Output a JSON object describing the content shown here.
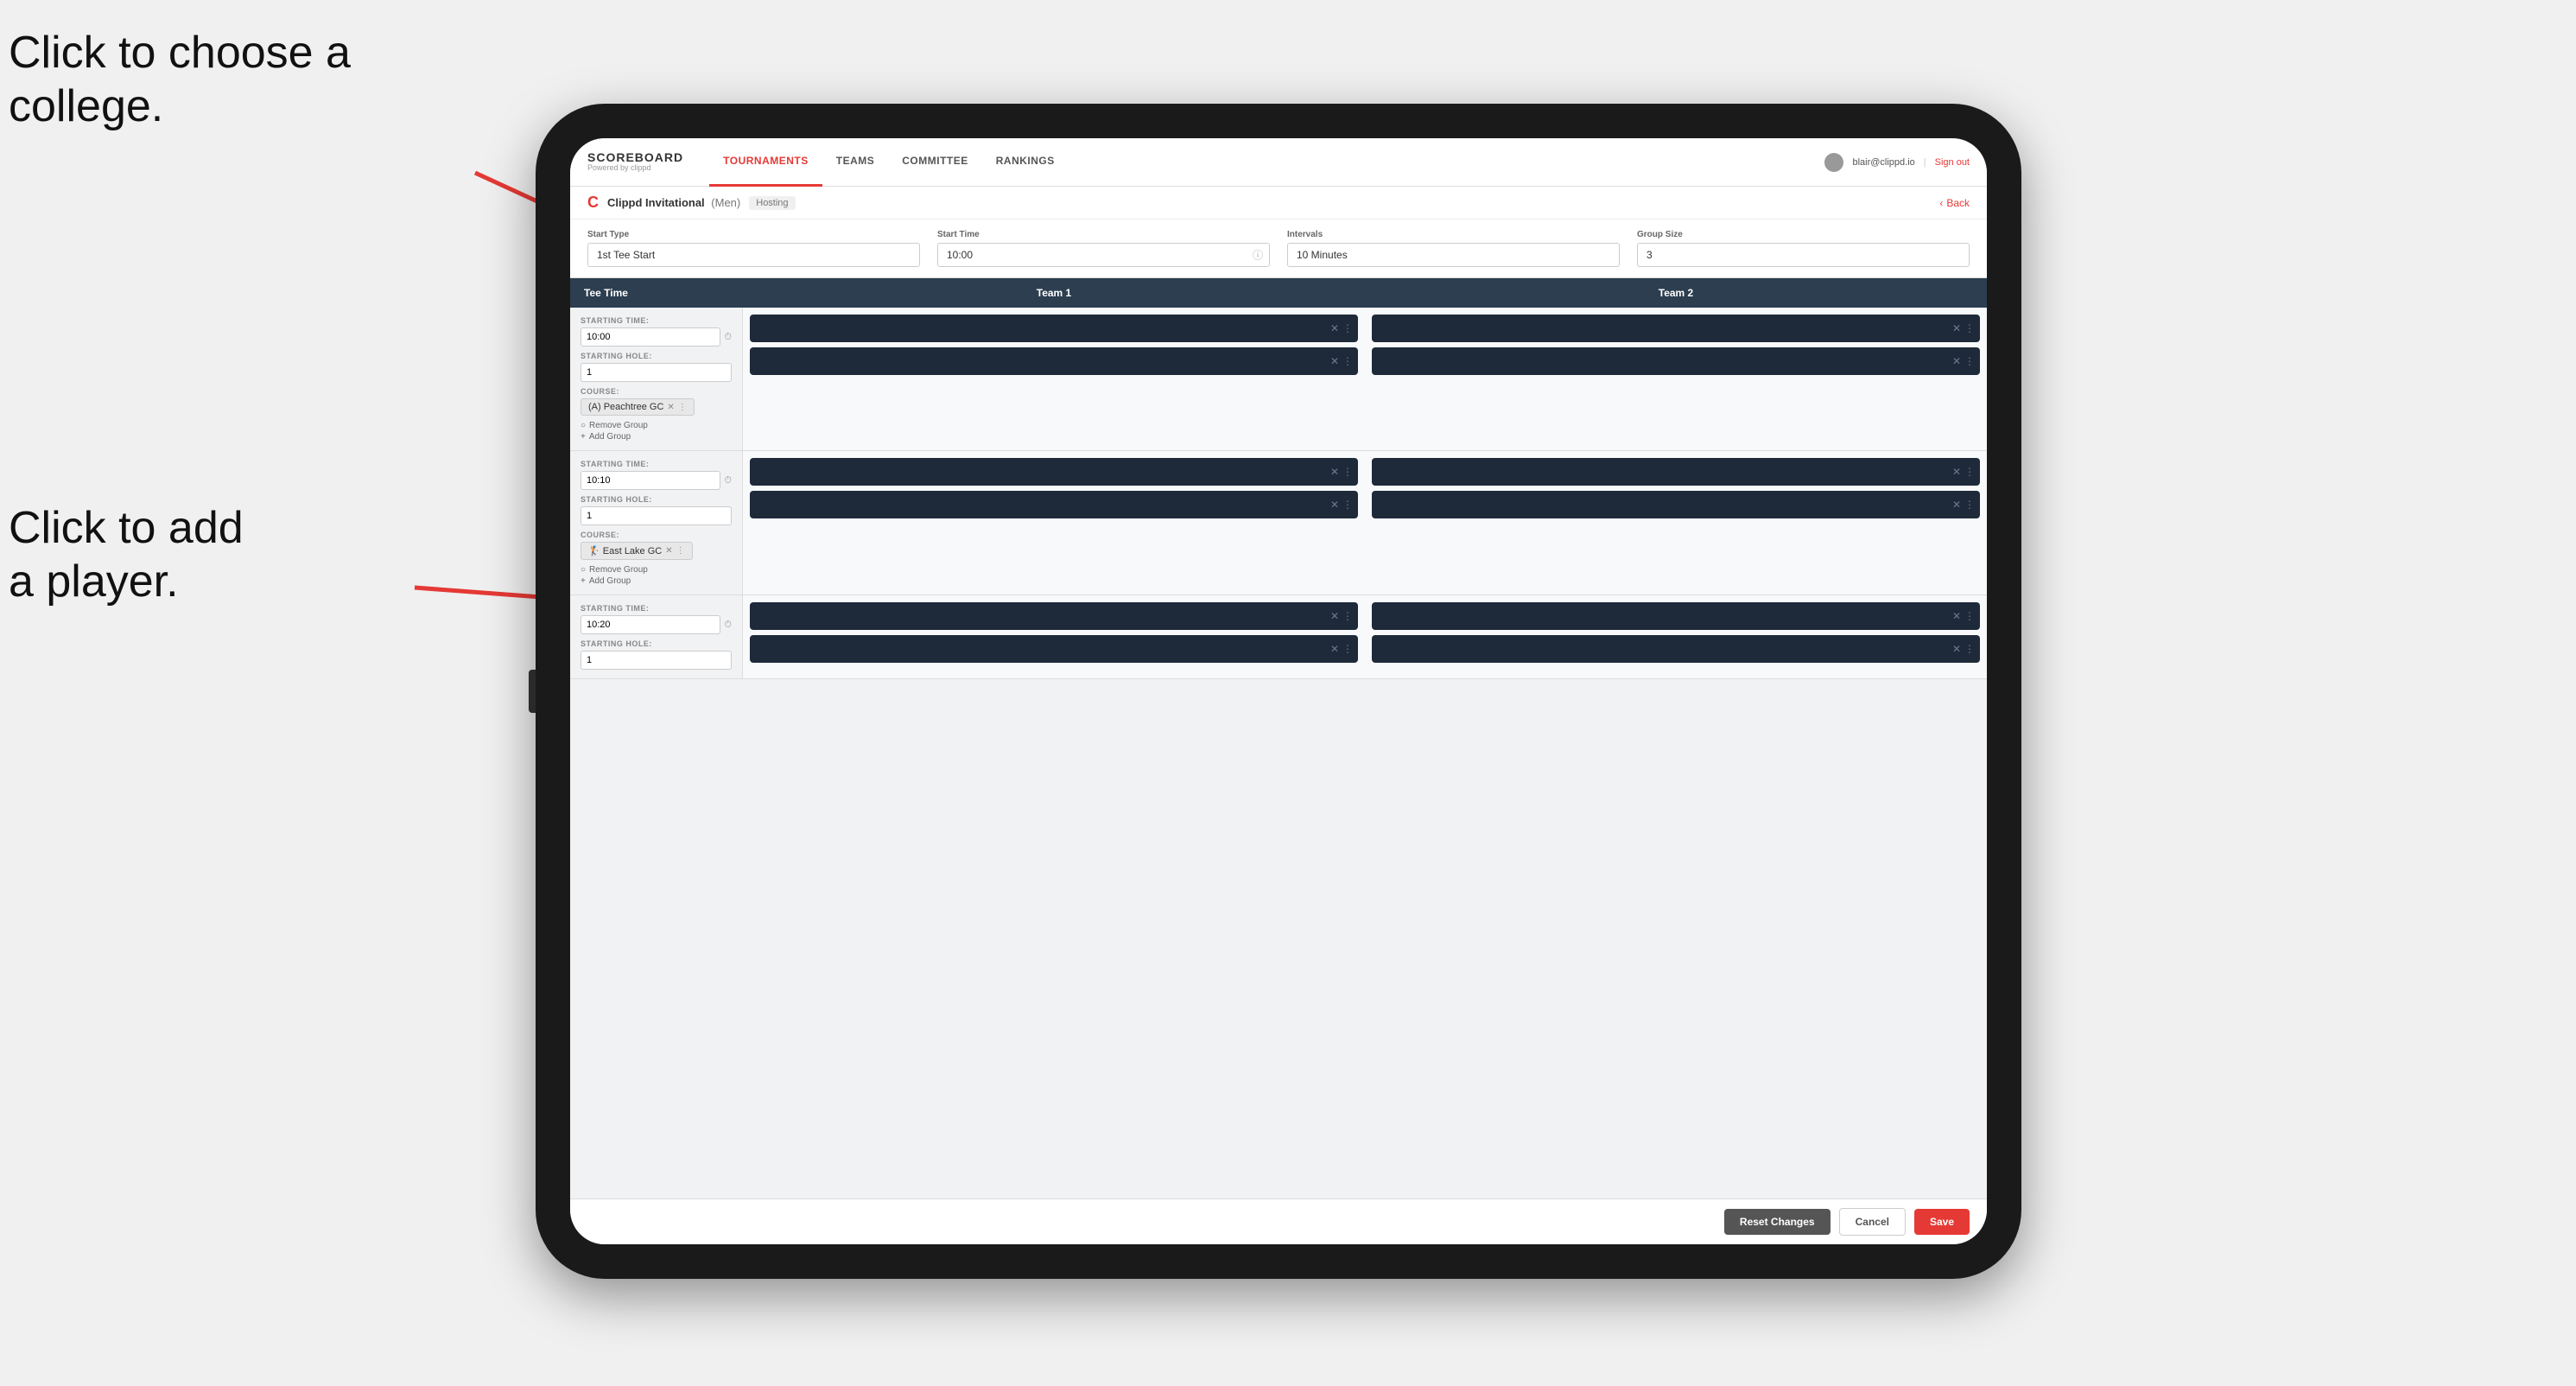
{
  "annotations": {
    "text1_line1": "Click to choose a",
    "text1_line2": "college.",
    "text2_line1": "Click to add",
    "text2_line2": "a player."
  },
  "nav": {
    "brand": "SCOREBOARD",
    "powered_by": "Powered by clippd",
    "links": [
      "TOURNAMENTS",
      "TEAMS",
      "COMMITTEE",
      "RANKINGS"
    ],
    "active_link": "TOURNAMENTS",
    "user_email": "blair@clippd.io",
    "sign_out": "Sign out"
  },
  "breadcrumb": {
    "tournament_name": "Clippd Invitational",
    "gender": "(Men)",
    "status": "Hosting",
    "back_label": "Back"
  },
  "settings": {
    "start_type_label": "Start Type",
    "start_type_value": "1st Tee Start",
    "start_time_label": "Start Time",
    "start_time_value": "10:00",
    "intervals_label": "Intervals",
    "intervals_value": "10 Minutes",
    "group_size_label": "Group Size",
    "group_size_value": "3"
  },
  "table": {
    "tee_time_col": "Tee Time",
    "team1_col": "Team 1",
    "team2_col": "Team 2"
  },
  "groups": [
    {
      "id": 1,
      "starting_time": "10:00",
      "starting_hole": "1",
      "course": "(A) Peachtree GC",
      "team1_slots": 2,
      "team2_slots": 2
    },
    {
      "id": 2,
      "starting_time": "10:10",
      "starting_hole": "1",
      "course": "East Lake GC",
      "course_icon": "🏌",
      "team1_slots": 2,
      "team2_slots": 2
    },
    {
      "id": 3,
      "starting_time": "10:20",
      "starting_hole": "1",
      "course": "",
      "team1_slots": 2,
      "team2_slots": 2
    }
  ],
  "labels": {
    "starting_time": "STARTING TIME:",
    "starting_hole": "STARTING HOLE:",
    "course": "COURSE:",
    "remove_group": "Remove Group",
    "add_group": "Add Group",
    "reset_changes": "Reset Changes",
    "cancel": "Cancel",
    "save": "Save"
  },
  "colors": {
    "accent": "#e53935",
    "dark_nav": "#2c3e50",
    "slot_bg": "#1e2a3a"
  }
}
